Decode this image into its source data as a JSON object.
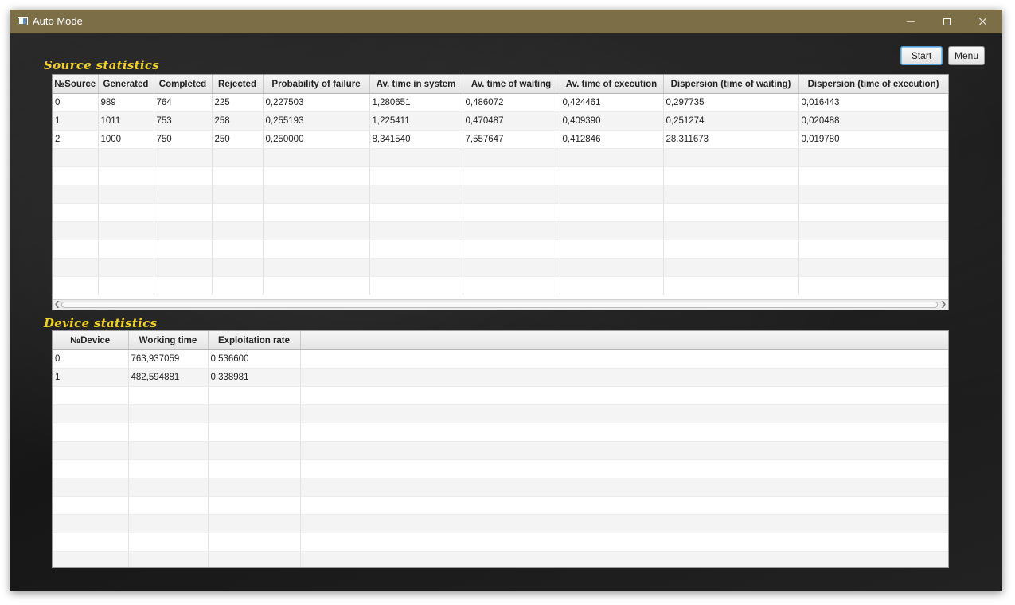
{
  "window": {
    "title": "Auto Mode",
    "controls": {
      "minimize": "minimize-icon",
      "maximize": "maximize-icon",
      "close": "close-icon"
    }
  },
  "toolbar": {
    "start_label": "Start",
    "menu_label": "Menu"
  },
  "source_stats": {
    "title": "Source statistics",
    "columns": [
      "№Source",
      "Generated",
      "Completed",
      "Rejected",
      "Probability of failure",
      "Av. time in system",
      "Av. time of waiting",
      "Av. time of execution",
      "Dispersion (time of waiting)",
      "Dispersion (time of execution)"
    ],
    "rows": [
      [
        "0",
        "989",
        "764",
        "225",
        "0,227503",
        "1,280651",
        "0,486072",
        "0,424461",
        "0,297735",
        "0,016443"
      ],
      [
        "1",
        "1011",
        "753",
        "258",
        "0,255193",
        "1,225411",
        "0,470487",
        "0,409390",
        "0,251274",
        "0,020488"
      ],
      [
        "2",
        "1000",
        "750",
        "250",
        "0,250000",
        "8,341540",
        "7,557647",
        "0,412846",
        "28,311673",
        "0,019780"
      ]
    ]
  },
  "device_stats": {
    "title": "Device statistics",
    "columns": [
      "№Device",
      "Working time",
      "Exploitation rate"
    ],
    "rows": [
      [
        "0",
        "763,937059",
        "0,536600"
      ],
      [
        "1",
        "482,594881",
        "0,338981"
      ]
    ]
  },
  "colors": {
    "titlebar": "#7c6f47",
    "section_title": "#f2cf2a",
    "background": "#1b1b1b",
    "focus_accent": "#4f9fd6"
  }
}
